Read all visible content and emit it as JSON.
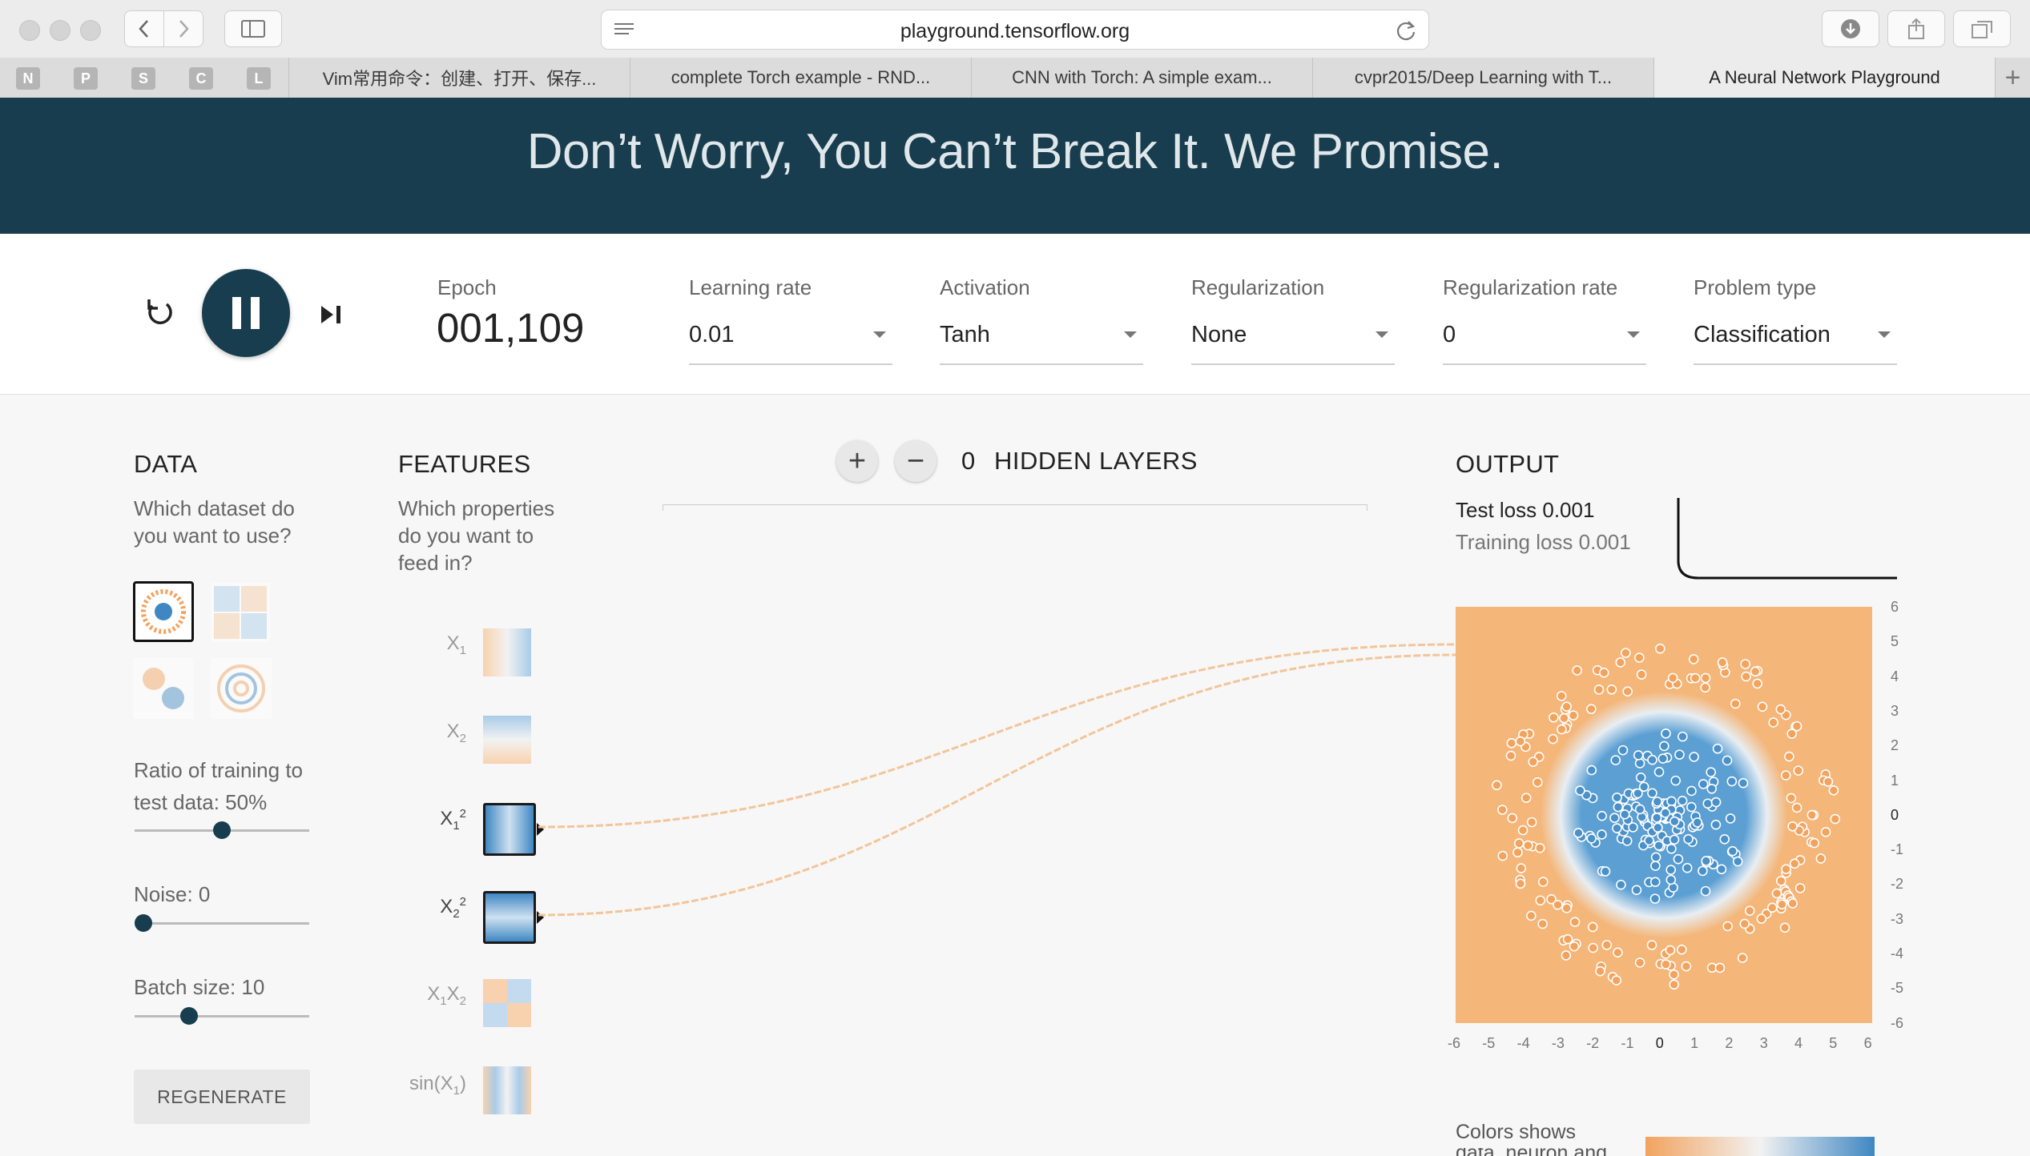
{
  "browser": {
    "url": "playground.tensorflow.org",
    "favorites": [
      "N",
      "P",
      "S",
      "C",
      "L"
    ],
    "tabs": [
      {
        "label": "Vim常用命令：创建、打开、保存..."
      },
      {
        "label": "complete Torch example - RND..."
      },
      {
        "label": "CNN with Torch: A simple exam..."
      },
      {
        "label": "cvpr2015/Deep Learning with T..."
      },
      {
        "label": "A Neural Network Playground"
      }
    ],
    "new_tab": "+"
  },
  "hero": {
    "text": "Don’t Worry, You Can’t Break It. We Promise."
  },
  "controls": {
    "epoch_label": "Epoch",
    "epoch_value": "001,109",
    "learning_rate": {
      "label": "Learning rate",
      "value": "0.01"
    },
    "activation": {
      "label": "Activation",
      "value": "Tanh"
    },
    "regularization": {
      "label": "Regularization",
      "value": "None"
    },
    "regularization_rate": {
      "label": "Regularization rate",
      "value": "0"
    },
    "problem_type": {
      "label": "Problem type",
      "value": "Classification"
    }
  },
  "data_panel": {
    "heading": "DATA",
    "subtitle_line1": "Which dataset do",
    "subtitle_line2": "you want to use?",
    "ratio_line1": "Ratio of training to",
    "ratio_line2": "test data:  50%",
    "ratio_fraction": 0.5,
    "noise_label": "Noise:  0",
    "noise_fraction": 0.0,
    "batch_label": "Batch size:  10",
    "batch_fraction": 0.31,
    "regenerate": "REGENERATE"
  },
  "features_panel": {
    "heading": "FEATURES",
    "line1": "Which properties",
    "line2": "do you want to",
    "line3": "feed in?",
    "features": [
      {
        "base": "X",
        "sub": "1",
        "sup": "",
        "active": false
      },
      {
        "base": "X",
        "sub": "2",
        "sup": "",
        "active": false
      },
      {
        "base": "X",
        "sub": "1",
        "sup": "2",
        "active": true
      },
      {
        "base": "X",
        "sub": "2",
        "sup": "2",
        "active": true
      },
      {
        "base": "X",
        "sub": "1",
        "base2": "X",
        "sub2": "2",
        "active": false
      },
      {
        "base": "sin(X",
        "sub": "1",
        "after": ")",
        "active": false
      }
    ]
  },
  "hidden_layers": {
    "count": "0",
    "label": "HIDDEN LAYERS",
    "add": "+",
    "remove": "−"
  },
  "output": {
    "heading": "OUTPUT",
    "test_loss": "Test loss 0.001",
    "training_loss": "Training loss 0.001",
    "y_ticks": [
      "6",
      "5",
      "4",
      "3",
      "2",
      "1",
      "0",
      "-1",
      "-2",
      "-3",
      "-4",
      "-5",
      "-6"
    ],
    "x_ticks": [
      "-6",
      "-5",
      "-4",
      "-3",
      "-2",
      "-1",
      "0",
      "1",
      "2",
      "3",
      "4",
      "5",
      "6"
    ],
    "colors_label": "Colors shows",
    "colors_label2": "data, neuron and",
    "colors": {
      "positive": "#4a90c9",
      "negative": "#f2a35e",
      "background_neg": "#f4b679",
      "background_pos": "#5b9fd3"
    }
  }
}
